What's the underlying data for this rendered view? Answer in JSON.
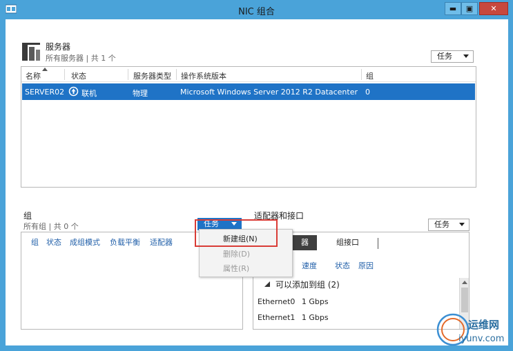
{
  "window": {
    "title": "NIC 组合",
    "minimize_label": "▬",
    "maximize_label": "▣",
    "close_label": "✕"
  },
  "servers": {
    "title": "服务器",
    "subtitle": "所有服务器 | 共 1 个",
    "tasks_label": "任务",
    "columns": [
      "名称",
      "状态",
      "服务器类型",
      "操作系统版本",
      "组"
    ],
    "rows": [
      {
        "name": "SERVER02",
        "status": "联机",
        "type": "物理",
        "os": "Microsoft Windows Server 2012 R2 Datacenter",
        "teams": "0"
      }
    ]
  },
  "teams": {
    "title": "组",
    "subtitle": "所有组 | 共 0 个",
    "tasks_label": "任务",
    "columns": [
      "组",
      "状态",
      "成组模式",
      "负载平衡",
      "适配器"
    ],
    "menu": [
      {
        "label": "新建组(N)",
        "enabled": true
      },
      {
        "label": "删除(D)",
        "enabled": false
      },
      {
        "label": "属性(R)",
        "enabled": false
      }
    ]
  },
  "adapters": {
    "title": "适配器和接口",
    "tasks_label": "任务",
    "tabs": [
      "网络适配器",
      "组接口"
    ],
    "tab_active_visible": "器",
    "columns": [
      "速度",
      "状态",
      "原因"
    ],
    "group_label": "可以添加到组 (2)",
    "rows": [
      {
        "name": "Ethernet0",
        "speed": "1 Gbps"
      },
      {
        "name": "Ethernet1",
        "speed": "1 Gbps"
      }
    ]
  },
  "watermark": {
    "name": "运维网",
    "url": "iyunv.com"
  },
  "colors": {
    "titlebar": "#4aa3d9",
    "selection": "#1f73c6",
    "highlight": "#d93b35",
    "close": "#c7483d"
  }
}
